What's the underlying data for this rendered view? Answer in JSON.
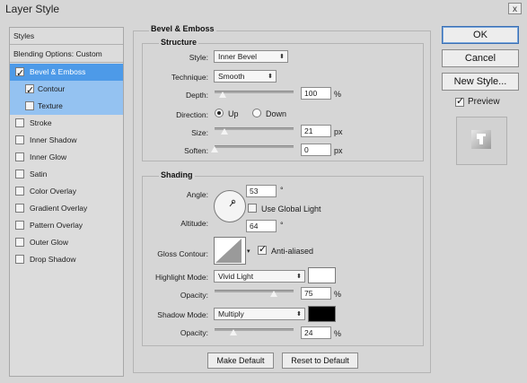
{
  "window": {
    "title": "Layer Style",
    "close_label": "x"
  },
  "left_panel": {
    "items": [
      {
        "label": "Styles",
        "checked": null
      },
      {
        "label": "Blending Options: Custom",
        "checked": null
      },
      {
        "label": "Bevel & Emboss",
        "checked": true
      },
      {
        "label": "Contour",
        "checked": true
      },
      {
        "label": "Texture",
        "checked": false
      },
      {
        "label": "Stroke",
        "checked": false
      },
      {
        "label": "Inner Shadow",
        "checked": false
      },
      {
        "label": "Inner Glow",
        "checked": false
      },
      {
        "label": "Satin",
        "checked": false
      },
      {
        "label": "Color Overlay",
        "checked": false
      },
      {
        "label": "Gradient Overlay",
        "checked": false
      },
      {
        "label": "Pattern Overlay",
        "checked": false
      },
      {
        "label": "Outer Glow",
        "checked": false
      },
      {
        "label": "Drop Shadow",
        "checked": false
      }
    ]
  },
  "panel": {
    "title": "Bevel & Emboss"
  },
  "structure": {
    "title": "Structure",
    "style_label": "Style:",
    "style_value": "Inner Bevel",
    "technique_label": "Technique:",
    "technique_value": "Smooth",
    "depth_label": "Depth:",
    "depth_value": "100",
    "depth_unit": "%",
    "depth_level": 0.1,
    "direction_label": "Direction:",
    "direction_up": "Up",
    "direction_down": "Down",
    "direction_selected": "Up",
    "size_label": "Size:",
    "size_value": "21",
    "size_unit": "px",
    "size_level": 0.12,
    "soften_label": "Soften:",
    "soften_value": "0",
    "soften_unit": "px",
    "soften_level": 0.0
  },
  "shading": {
    "title": "Shading",
    "angle_label": "Angle:",
    "angle_value": "53",
    "angle_unit": "°",
    "global_light_label": "Use Global Light",
    "global_light_checked": false,
    "altitude_label": "Altitude:",
    "altitude_value": "64",
    "altitude_unit": "°",
    "gloss_label": "Gloss Contour:",
    "antialiased_label": "Anti-aliased",
    "antialiased_checked": true,
    "highlight_mode_label": "Highlight Mode:",
    "highlight_mode_value": "Vivid Light",
    "highlight_color": "#ffffff",
    "highlight_opacity_label": "Opacity:",
    "highlight_opacity_value": "75",
    "highlight_opacity_unit": "%",
    "highlight_opacity_level": 0.75,
    "shadow_mode_label": "Shadow Mode:",
    "shadow_mode_value": "Multiply",
    "shadow_color": "#000000",
    "shadow_opacity_label": "Opacity:",
    "shadow_opacity_value": "24",
    "shadow_opacity_unit": "%",
    "shadow_opacity_level": 0.24
  },
  "footer": {
    "make_default": "Make Default",
    "reset_default": "Reset to Default"
  },
  "right": {
    "ok": "OK",
    "cancel": "Cancel",
    "new_style": "New Style...",
    "preview_label": "Preview",
    "preview_checked": true
  },
  "colors": {
    "selected_row": "#4d9ae8",
    "sub_selected_row": "#94c2f1",
    "dialog_bg": "#d6d6d6"
  }
}
